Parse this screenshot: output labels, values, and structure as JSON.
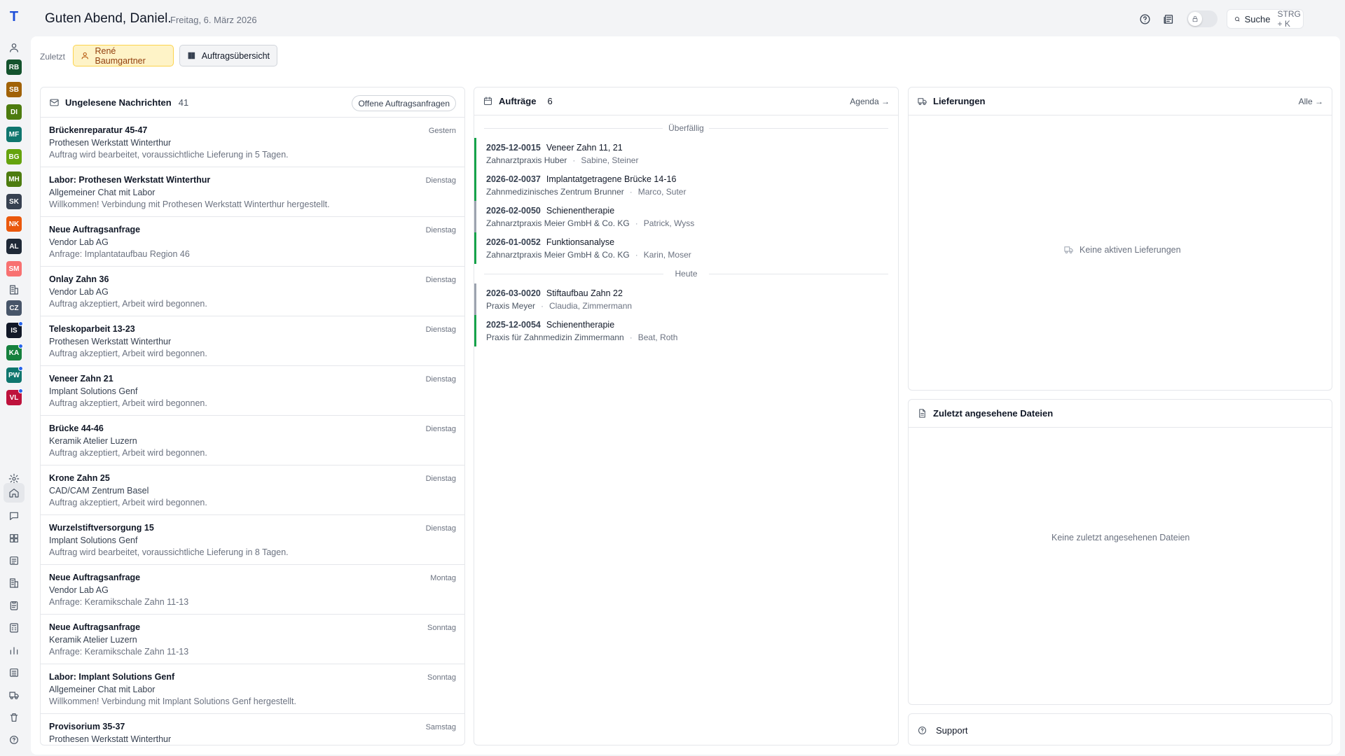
{
  "app": {
    "logo_letter": "T"
  },
  "header": {
    "greeting": "Guten Abend, Daniel.",
    "date": "Freitag, 6. März 2026",
    "search_label": "Suche",
    "search_shortcut": "STRG + K"
  },
  "rail": {
    "avatars": [
      {
        "initials": "RB",
        "color": "#14532d",
        "dot": false
      },
      {
        "initials": "SB",
        "color": "#a16207",
        "dot": false
      },
      {
        "initials": "DI",
        "color": "#4d7c0f",
        "dot": false
      },
      {
        "initials": "MF",
        "color": "#0f766e",
        "dot": false
      },
      {
        "initials": "BG",
        "color": "#65a30d",
        "dot": false
      },
      {
        "initials": "MH",
        "color": "#4d7c0f",
        "dot": false
      },
      {
        "initials": "SK",
        "color": "#374151",
        "dot": false
      },
      {
        "initials": "NK",
        "color": "#ea580c",
        "dot": false
      },
      {
        "initials": "AL",
        "color": "#1f2937",
        "dot": false
      },
      {
        "initials": "SM",
        "color": "#f87171",
        "dot": false
      },
      {
        "initials": "CZ",
        "color": "#475569",
        "dot": false
      },
      {
        "initials": "IS",
        "color": "#111827",
        "dot": true
      },
      {
        "initials": "KA",
        "color": "#15803d",
        "dot": true
      },
      {
        "initials": "PW",
        "color": "#0f766e",
        "dot": true
      },
      {
        "initials": "VL",
        "color": "#be123c",
        "dot": true
      }
    ]
  },
  "recent": {
    "label": "Zuletzt",
    "chips": [
      "René Baumgartner",
      "Auftragsübersicht"
    ]
  },
  "messages": {
    "title": "Ungelesene Nachrichten",
    "count": "41",
    "action": "Offene Auftragsanfragen",
    "items": [
      {
        "title": "Brückenreparatur 45-47",
        "sender": "Prothesen Werkstatt Winterthur",
        "preview": "Auftrag wird bearbeitet, voraussichtliche Lieferung in 5 Tagen.",
        "date": "Gestern"
      },
      {
        "title": "Labor: Prothesen Werkstatt Winterthur",
        "sender": "Allgemeiner Chat mit Labor",
        "preview": "Willkommen! Verbindung mit Prothesen Werkstatt Winterthur hergestellt.",
        "date": "Dienstag"
      },
      {
        "title": "Neue Auftragsanfrage",
        "sender": "Vendor Lab AG",
        "preview": "Anfrage: Implantataufbau Region 46",
        "date": "Dienstag"
      },
      {
        "title": "Onlay Zahn 36",
        "sender": "Vendor Lab AG",
        "preview": "Auftrag akzeptiert, Arbeit wird begonnen.",
        "date": "Dienstag"
      },
      {
        "title": "Teleskoparbeit 13-23",
        "sender": "Prothesen Werkstatt Winterthur",
        "preview": "Auftrag akzeptiert, Arbeit wird begonnen.",
        "date": "Dienstag"
      },
      {
        "title": "Veneer Zahn 21",
        "sender": "Implant Solutions Genf",
        "preview": "Auftrag akzeptiert, Arbeit wird begonnen.",
        "date": "Dienstag"
      },
      {
        "title": "Brücke 44-46",
        "sender": "Keramik Atelier Luzern",
        "preview": "Auftrag akzeptiert, Arbeit wird begonnen.",
        "date": "Dienstag"
      },
      {
        "title": "Krone Zahn 25",
        "sender": "CAD/CAM Zentrum Basel",
        "preview": "Auftrag akzeptiert, Arbeit wird begonnen.",
        "date": "Dienstag"
      },
      {
        "title": "Wurzelstiftversorgung 15",
        "sender": "Implant Solutions Genf",
        "preview": "Auftrag wird bearbeitet, voraussichtliche Lieferung in 8 Tagen.",
        "date": "Dienstag"
      },
      {
        "title": "Neue Auftragsanfrage",
        "sender": "Vendor Lab AG",
        "preview": "Anfrage: Keramikschale Zahn 11-13",
        "date": "Montag"
      },
      {
        "title": "Neue Auftragsanfrage",
        "sender": "Keramik Atelier Luzern",
        "preview": "Anfrage: Keramikschale Zahn 11-13",
        "date": "Sonntag"
      },
      {
        "title": "Labor: Implant Solutions Genf",
        "sender": "Allgemeiner Chat mit Labor",
        "preview": "Willkommen! Verbindung mit Implant Solutions Genf hergestellt.",
        "date": "Sonntag"
      },
      {
        "title": "Provisorium 35-37",
        "sender": "Prothesen Werkstatt Winterthur",
        "preview": "",
        "date": "Samstag"
      }
    ]
  },
  "orders": {
    "title": "Aufträge",
    "count": "6",
    "link": "Agenda",
    "sections": [
      {
        "label": "Überfällig",
        "items": [
          {
            "number": "2025-12-0015",
            "title": "Veneer Zahn 11, 21",
            "practice": "Zahnarztpraxis Huber",
            "patient": "Sabine, Steiner",
            "status": "green"
          },
          {
            "number": "2026-02-0037",
            "title": "Implantatgetragene Brücke 14-16",
            "practice": "Zahnmedizinisches Zentrum Brunner",
            "patient": "Marco, Suter",
            "status": "green"
          },
          {
            "number": "2026-02-0050",
            "title": "Schienentherapie",
            "practice": "Zahnarztpraxis Meier GmbH & Co. KG",
            "patient": "Patrick, Wyss",
            "status": "gray"
          },
          {
            "number": "2026-01-0052",
            "title": "Funktionsanalyse",
            "practice": "Zahnarztpraxis Meier GmbH & Co. KG",
            "patient": "Karin, Moser",
            "status": "green"
          }
        ]
      },
      {
        "label": "Heute",
        "items": [
          {
            "number": "2026-03-0020",
            "title": "Stiftaufbau Zahn 22",
            "practice": "Praxis Meyer",
            "patient": "Claudia, Zimmermann",
            "status": "gray"
          },
          {
            "number": "2025-12-0054",
            "title": "Schienentherapie",
            "practice": "Praxis für Zahnmedizin Zimmermann",
            "patient": "Beat, Roth",
            "status": "green"
          }
        ]
      }
    ]
  },
  "deliveries": {
    "title": "Lieferungen",
    "link": "Alle",
    "empty": "Keine aktiven Lieferungen"
  },
  "files": {
    "title": "Zuletzt angesehene Dateien",
    "empty": "Keine zuletzt angesehenen Dateien"
  },
  "support": {
    "label": "Support"
  }
}
